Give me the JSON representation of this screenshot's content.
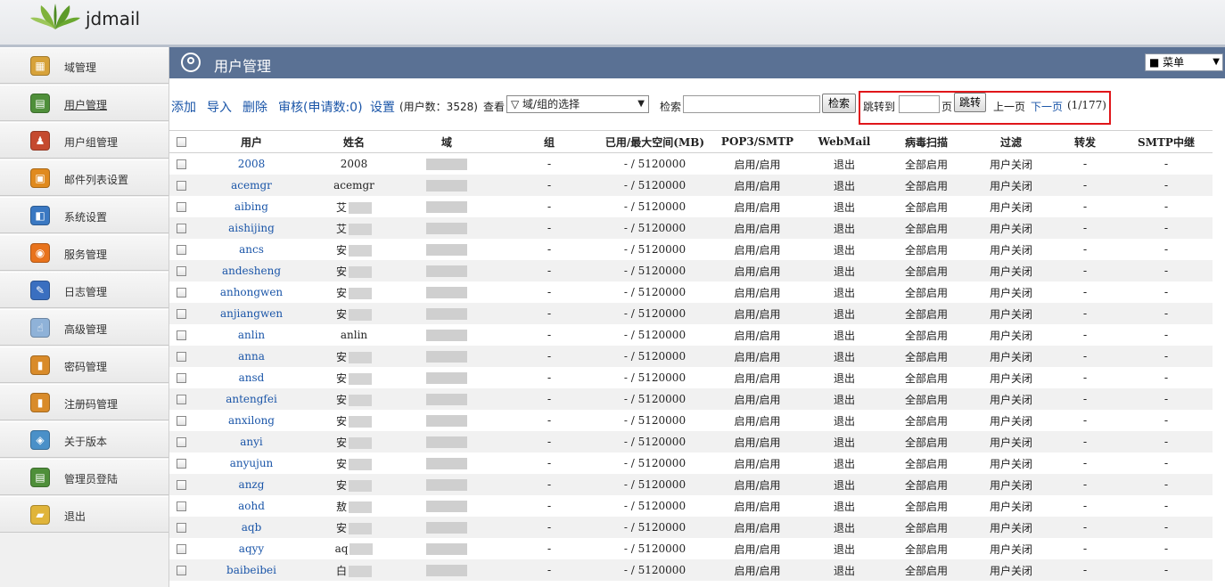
{
  "app": {
    "name": "jdmail"
  },
  "sidebar": {
    "items": [
      {
        "label": "域管理",
        "icon": "domain-icon",
        "color": "#d7a23a"
      },
      {
        "label": "用户管理",
        "icon": "user-card-icon",
        "color": "#4f8f3a"
      },
      {
        "label": "用户组管理",
        "icon": "user-group-icon",
        "color": "#c54a2f"
      },
      {
        "label": "邮件列表设置",
        "icon": "mail-list-icon",
        "color": "#e08a1e"
      },
      {
        "label": "系统设置",
        "icon": "system-settings-icon",
        "color": "#3a78c2"
      },
      {
        "label": "服务管理",
        "icon": "rss-service-icon",
        "color": "#e8731c"
      },
      {
        "label": "日志管理",
        "icon": "log-edit-icon",
        "color": "#3a6fc0"
      },
      {
        "label": "高级管理",
        "icon": "pointer-hand-icon",
        "color": "#8fb2d8"
      },
      {
        "label": "密码管理",
        "icon": "password-icon",
        "color": "#d98b2a"
      },
      {
        "label": "注册码管理",
        "icon": "register-code-icon",
        "color": "#d98b2a"
      },
      {
        "label": "关于版本",
        "icon": "package-icon",
        "color": "#4a90c8"
      },
      {
        "label": "管理员登陆",
        "icon": "admin-login-icon",
        "color": "#4f8f3a"
      },
      {
        "label": "退出",
        "icon": "exit-folder-icon",
        "color": "#e0b43a"
      }
    ]
  },
  "main": {
    "title": "用户管理",
    "menu_select": "■ 菜单"
  },
  "toolbar": {
    "add": "添加",
    "import": "导入",
    "delete": "删除",
    "review": "审核(申请数:0)",
    "settings": "设置",
    "user_count": "(用户数：3528)",
    "view_label": "查看",
    "group_select": "▽ 域/组的选择",
    "search_label": "检索",
    "search_button": "检索",
    "jump_label": "跳转到",
    "page_unit": "页",
    "jump_button": "跳转",
    "prev_page": "上一页",
    "next_page": "下一页",
    "page_info": "(1/177)"
  },
  "table": {
    "headers": [
      "用户",
      "姓名",
      "域",
      "组",
      "已用/最大空间(MB)",
      "POP3/SMTP",
      "WebMail",
      "病毒扫描",
      "过滤",
      "转发",
      "SMTP中继"
    ],
    "rows": [
      {
        "user": "2008",
        "name": "2008",
        "group": "-",
        "space": "- / 5120000",
        "pop3": "启用/启用",
        "webmail": "退出",
        "virus": "全部启用",
        "filter": "用户关闭",
        "forward": "-",
        "relay": "-"
      },
      {
        "user": "acemgr",
        "name": "acemgr",
        "group": "-",
        "space": "- / 5120000",
        "pop3": "启用/启用",
        "webmail": "退出",
        "virus": "全部启用",
        "filter": "用户关闭",
        "forward": "-",
        "relay": "-"
      },
      {
        "user": "aibing",
        "name": "艾",
        "group": "-",
        "space": "- / 5120000",
        "pop3": "启用/启用",
        "webmail": "退出",
        "virus": "全部启用",
        "filter": "用户关闭",
        "forward": "-",
        "relay": "-"
      },
      {
        "user": "aishijing",
        "name": "艾",
        "group": "-",
        "space": "- / 5120000",
        "pop3": "启用/启用",
        "webmail": "退出",
        "virus": "全部启用",
        "filter": "用户关闭",
        "forward": "-",
        "relay": "-"
      },
      {
        "user": "ancs",
        "name": "安",
        "group": "-",
        "space": "- / 5120000",
        "pop3": "启用/启用",
        "webmail": "退出",
        "virus": "全部启用",
        "filter": "用户关闭",
        "forward": "-",
        "relay": "-"
      },
      {
        "user": "andesheng",
        "name": "安",
        "group": "-",
        "space": "- / 5120000",
        "pop3": "启用/启用",
        "webmail": "退出",
        "virus": "全部启用",
        "filter": "用户关闭",
        "forward": "-",
        "relay": "-"
      },
      {
        "user": "anhongwen",
        "name": "安",
        "group": "-",
        "space": "- / 5120000",
        "pop3": "启用/启用",
        "webmail": "退出",
        "virus": "全部启用",
        "filter": "用户关闭",
        "forward": "-",
        "relay": "-"
      },
      {
        "user": "anjiangwen",
        "name": "安",
        "group": "-",
        "space": "- / 5120000",
        "pop3": "启用/启用",
        "webmail": "退出",
        "virus": "全部启用",
        "filter": "用户关闭",
        "forward": "-",
        "relay": "-"
      },
      {
        "user": "anlin",
        "name": "anlin",
        "group": "-",
        "space": "- / 5120000",
        "pop3": "启用/启用",
        "webmail": "退出",
        "virus": "全部启用",
        "filter": "用户关闭",
        "forward": "-",
        "relay": "-"
      },
      {
        "user": "anna",
        "name": "安",
        "group": "-",
        "space": "- / 5120000",
        "pop3": "启用/启用",
        "webmail": "退出",
        "virus": "全部启用",
        "filter": "用户关闭",
        "forward": "-",
        "relay": "-"
      },
      {
        "user": "ansd",
        "name": "安",
        "group": "-",
        "space": "- / 5120000",
        "pop3": "启用/启用",
        "webmail": "退出",
        "virus": "全部启用",
        "filter": "用户关闭",
        "forward": "-",
        "relay": "-"
      },
      {
        "user": "antengfei",
        "name": "安",
        "group": "-",
        "space": "- / 5120000",
        "pop3": "启用/启用",
        "webmail": "退出",
        "virus": "全部启用",
        "filter": "用户关闭",
        "forward": "-",
        "relay": "-"
      },
      {
        "user": "anxilong",
        "name": "安",
        "group": "-",
        "space": "- / 5120000",
        "pop3": "启用/启用",
        "webmail": "退出",
        "virus": "全部启用",
        "filter": "用户关闭",
        "forward": "-",
        "relay": "-"
      },
      {
        "user": "anyi",
        "name": "安",
        "group": "-",
        "space": "- / 5120000",
        "pop3": "启用/启用",
        "webmail": "退出",
        "virus": "全部启用",
        "filter": "用户关闭",
        "forward": "-",
        "relay": "-"
      },
      {
        "user": "anyujun",
        "name": "安",
        "group": "-",
        "space": "- / 5120000",
        "pop3": "启用/启用",
        "webmail": "退出",
        "virus": "全部启用",
        "filter": "用户关闭",
        "forward": "-",
        "relay": "-"
      },
      {
        "user": "anzg",
        "name": "安",
        "group": "-",
        "space": "- / 5120000",
        "pop3": "启用/启用",
        "webmail": "退出",
        "virus": "全部启用",
        "filter": "用户关闭",
        "forward": "-",
        "relay": "-"
      },
      {
        "user": "aohd",
        "name": "敖",
        "group": "-",
        "space": "- / 5120000",
        "pop3": "启用/启用",
        "webmail": "退出",
        "virus": "全部启用",
        "filter": "用户关闭",
        "forward": "-",
        "relay": "-"
      },
      {
        "user": "aqb",
        "name": "安",
        "group": "-",
        "space": "- / 5120000",
        "pop3": "启用/启用",
        "webmail": "退出",
        "virus": "全部启用",
        "filter": "用户关闭",
        "forward": "-",
        "relay": "-"
      },
      {
        "user": "aqyy",
        "name": "aq",
        "group": "-",
        "space": "- / 5120000",
        "pop3": "启用/启用",
        "webmail": "退出",
        "virus": "全部启用",
        "filter": "用户关闭",
        "forward": "-",
        "relay": "-"
      },
      {
        "user": "baibeibei",
        "name": "白",
        "group": "-",
        "space": "- / 5120000",
        "pop3": "启用/启用",
        "webmail": "退出",
        "virus": "全部启用",
        "filter": "用户关闭",
        "forward": "-",
        "relay": "-"
      }
    ]
  },
  "colors": {
    "header_bar": "#5a7194",
    "link": "#1a55a8",
    "pager_highlight": "#e0161a",
    "row_stripe": "#f1f1f1"
  }
}
